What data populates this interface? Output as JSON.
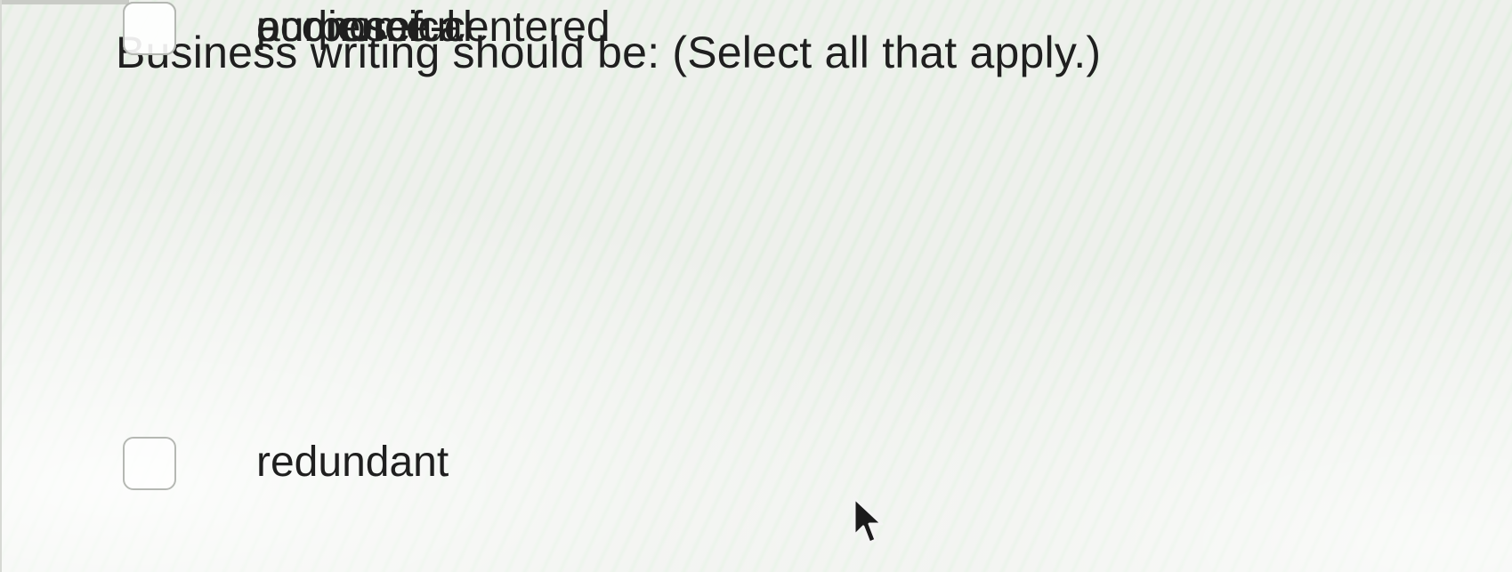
{
  "question": {
    "text": "Business writing should be: (Select all that apply.)"
  },
  "options": [
    {
      "label": "redundant",
      "checked": false
    },
    {
      "label": "purposeful",
      "checked": false
    },
    {
      "label": "economical",
      "checked": false
    },
    {
      "label": "audience-centered",
      "checked": false
    }
  ],
  "icons": {
    "pointer": "mouse-pointer-icon"
  },
  "colors": {
    "text": "#1f1f1f",
    "checkbox_border": "#b5b8b3"
  }
}
